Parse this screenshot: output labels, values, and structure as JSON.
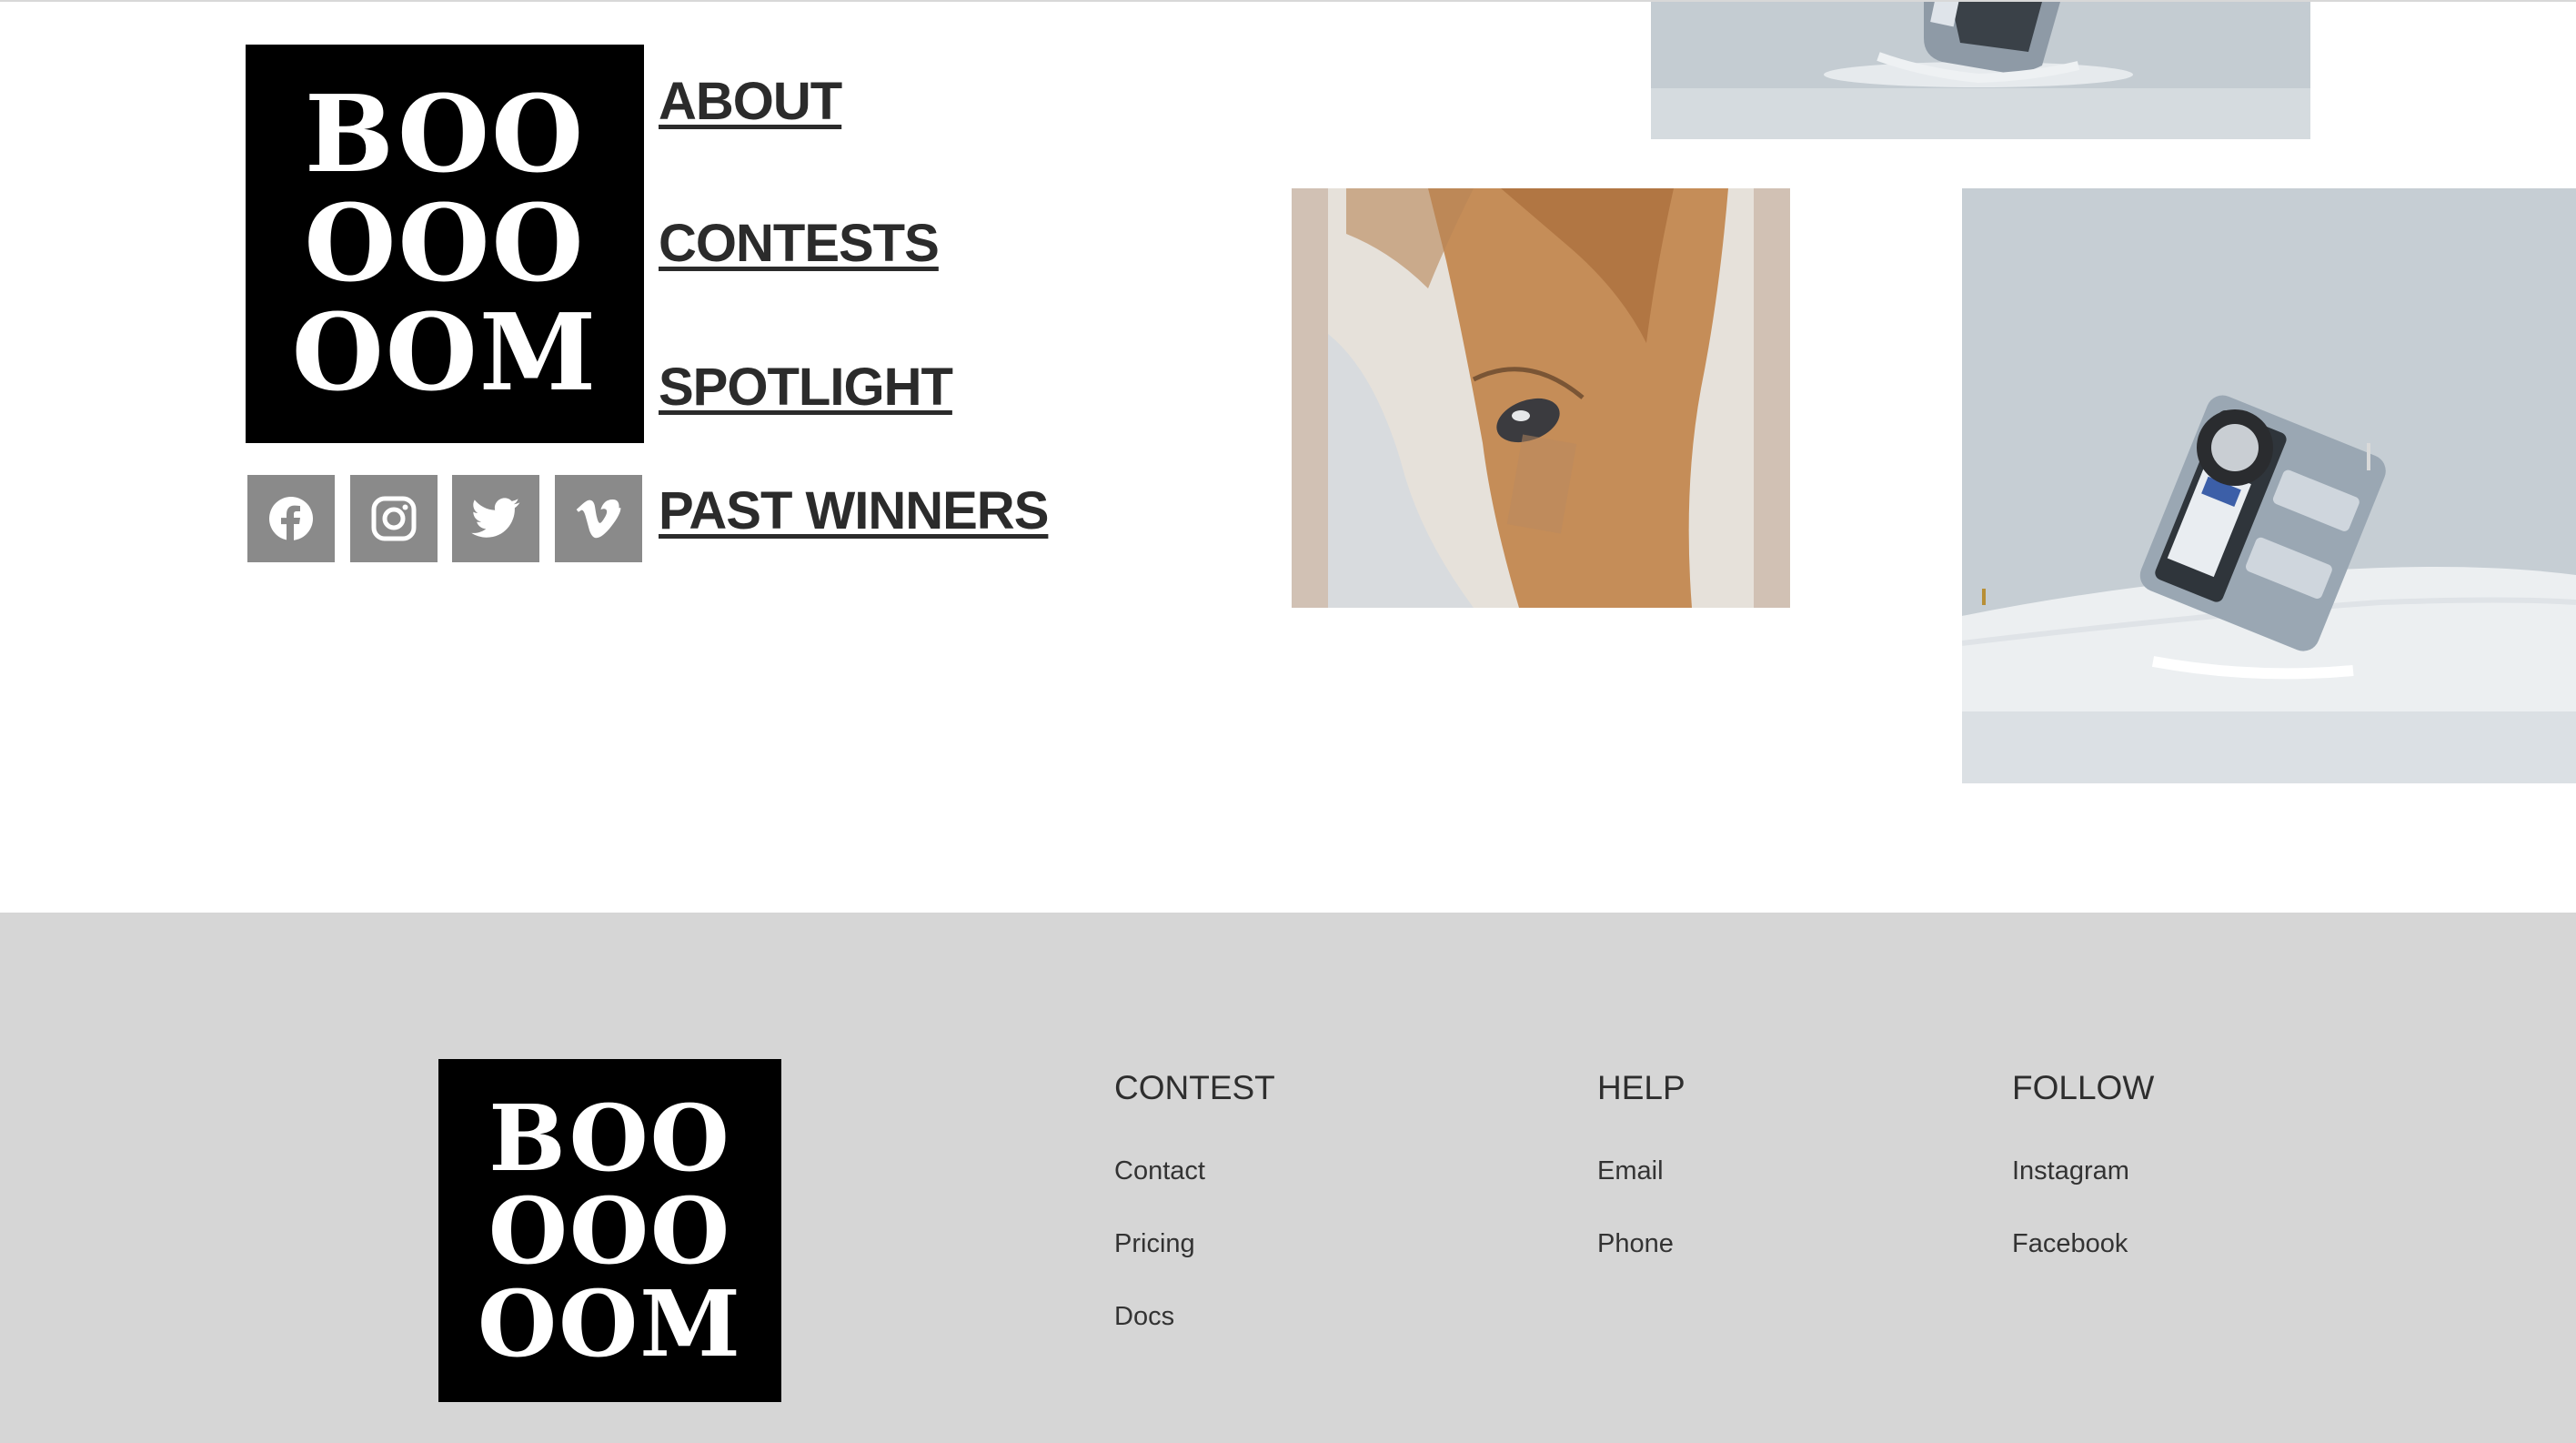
{
  "brand": {
    "logo_lines": [
      "BOO",
      "OOO",
      "OOM"
    ],
    "logo_bg": "#000000",
    "logo_fg": "#ffffff"
  },
  "nav": {
    "items": [
      {
        "label": "ABOUT"
      },
      {
        "label": "CONTESTS"
      },
      {
        "label": "SPOTLIGHT"
      },
      {
        "label": "PAST WINNERS"
      }
    ]
  },
  "social": {
    "icons": [
      "facebook-icon",
      "instagram-icon",
      "twitter-icon",
      "vimeo-icon"
    ],
    "tile_color": "#8a8a8a"
  },
  "footer": {
    "background": "#d6d6d6",
    "columns": [
      {
        "title": "CONTEST",
        "links": [
          "Contact",
          "Pricing",
          "Docs"
        ]
      },
      {
        "title": "HELP",
        "links": [
          "Email",
          "Phone"
        ]
      },
      {
        "title": "FOLLOW",
        "links": [
          "Instagram",
          "Facebook"
        ]
      }
    ]
  }
}
